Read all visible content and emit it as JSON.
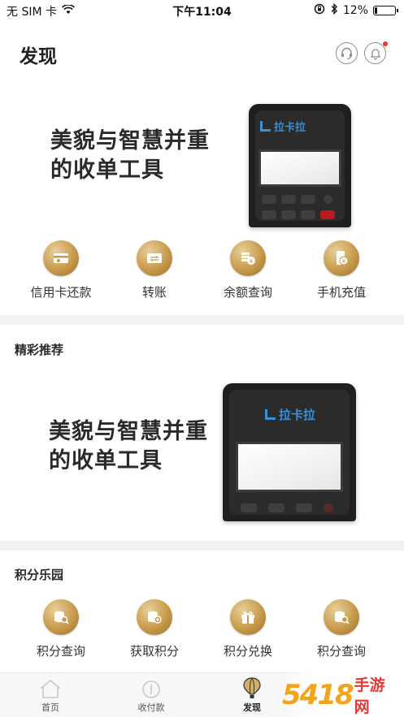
{
  "status": {
    "carrier": "无 SIM 卡",
    "time": "下午11:04",
    "battery_percent": "12%",
    "battery_level": 0.12
  },
  "header": {
    "title": "发现"
  },
  "banner1": {
    "headline_line1": "美貌与智慧并重",
    "headline_line2": "的收单工具",
    "device_brand": "拉卡拉"
  },
  "quick_actions": [
    {
      "label": "信用卡还款",
      "icon": "credit-card-icon"
    },
    {
      "label": "转账",
      "icon": "transfer-icon"
    },
    {
      "label": "余额查询",
      "icon": "balance-icon"
    },
    {
      "label": "手机充值",
      "icon": "phone-recharge-icon"
    }
  ],
  "featured": {
    "title": "精彩推荐",
    "headline_line1": "美貌与智慧并重",
    "headline_line2": "的收单工具",
    "device_brand": "拉卡拉"
  },
  "points": {
    "title": "积分乐园",
    "items": [
      {
        "label": "积分查询",
        "icon": "points-search-icon"
      },
      {
        "label": "获取积分",
        "icon": "points-add-icon"
      },
      {
        "label": "积分兑换",
        "icon": "gift-icon"
      },
      {
        "label": "积分查询",
        "icon": "points-search-icon"
      }
    ]
  },
  "tabbar": {
    "tabs": [
      {
        "label": "首页",
        "icon": "home-icon"
      },
      {
        "label": "收付款",
        "icon": "payment-icon"
      },
      {
        "label": "发现",
        "icon": "balloon-icon"
      }
    ],
    "active_index": 2
  },
  "watermark": {
    "text": "5418",
    "site": "手游网"
  },
  "colors": {
    "accent_gold": "#c79a4b",
    "notification_dot": "#e53935",
    "brand_blue": "#3a8fd6"
  }
}
